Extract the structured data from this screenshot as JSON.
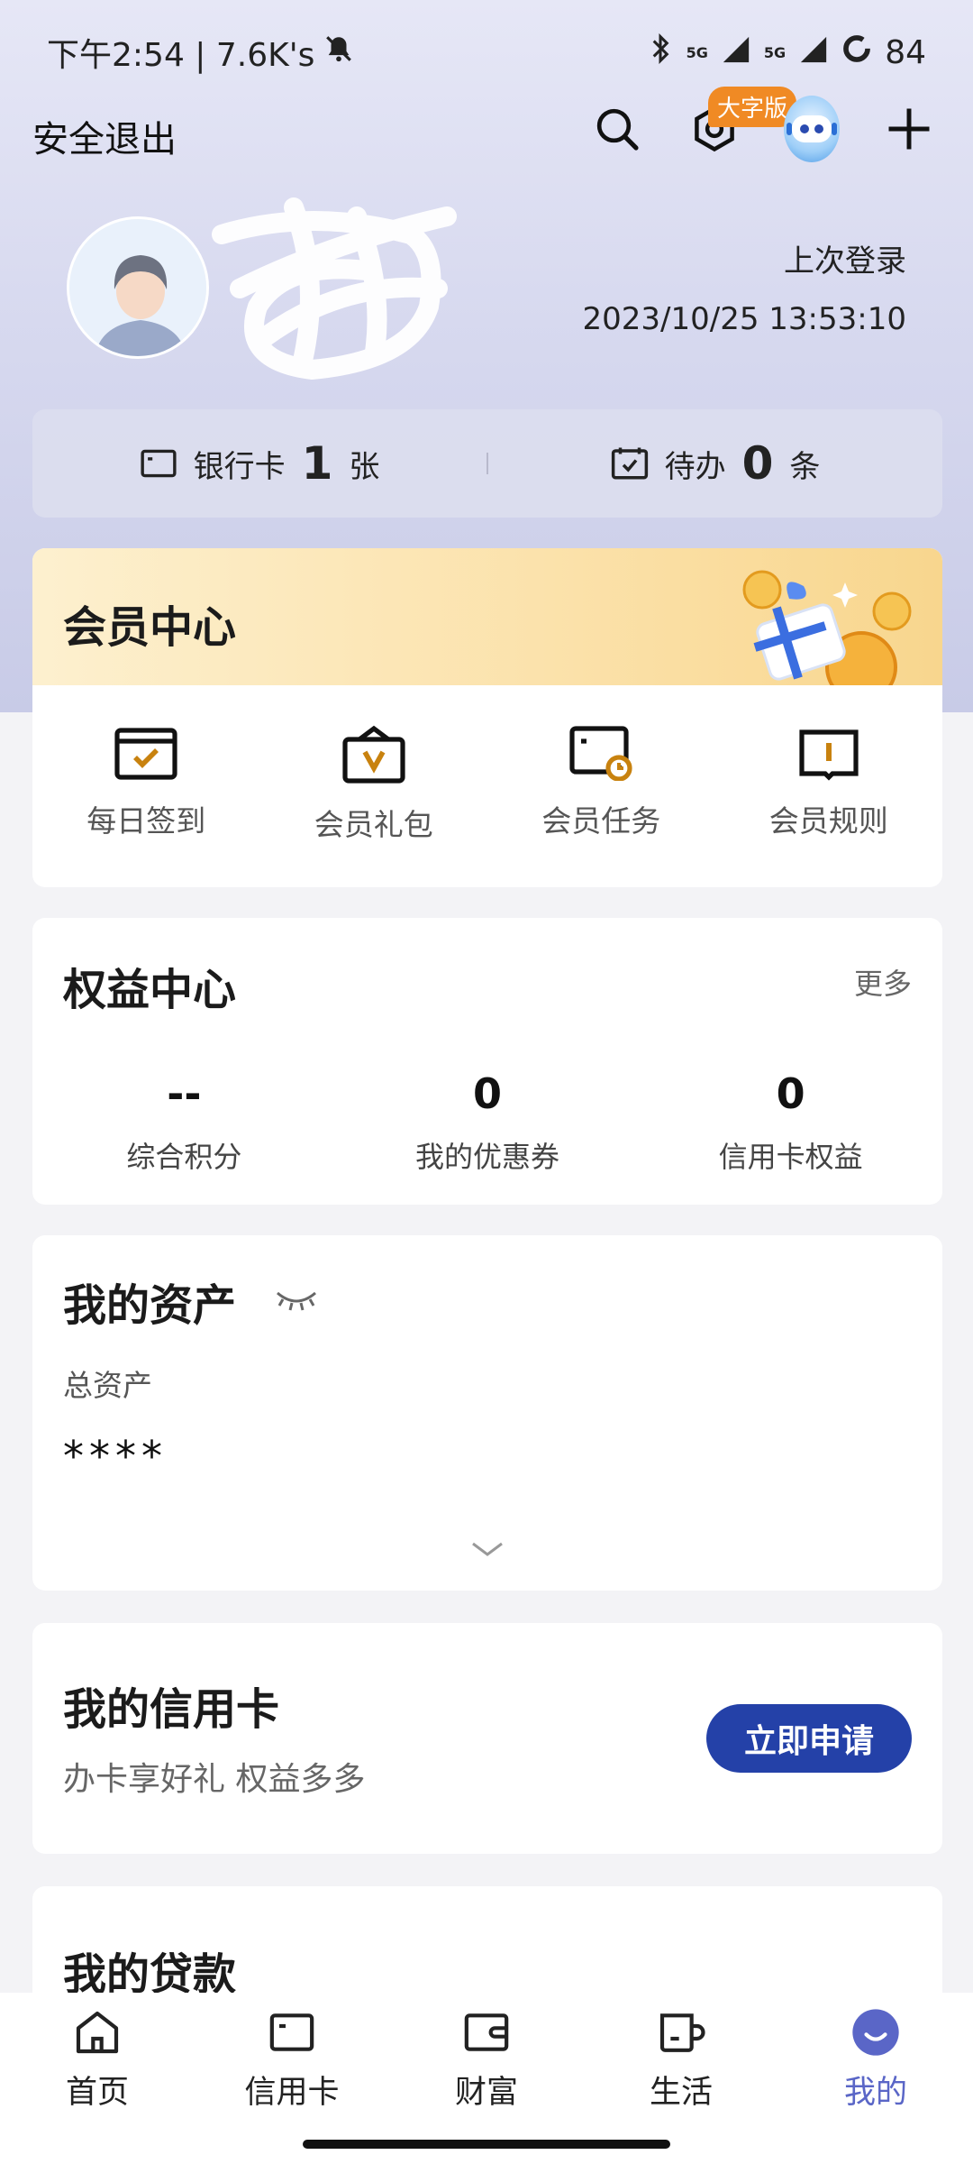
{
  "status_bar": {
    "time_speed": "下午2:54 | 7.6K's",
    "net1": "5G",
    "net2": "5G",
    "battery": "84"
  },
  "header": {
    "logout_label": "安全退出",
    "big_font_badge": "大字版"
  },
  "profile": {
    "last_login_label": "上次登录",
    "last_login_time": "2023/10/25 13:53:10"
  },
  "summary": {
    "bank_card_label": "银行卡",
    "bank_card_count": "1",
    "bank_card_unit": "张",
    "todo_label": "待办",
    "todo_count": "0",
    "todo_unit": "条"
  },
  "member_center": {
    "title": "会员中心",
    "items": [
      {
        "label": "每日签到",
        "icon": "calendar-check-icon"
      },
      {
        "label": "会员礼包",
        "icon": "gift-bag-icon"
      },
      {
        "label": "会员任务",
        "icon": "task-clock-icon"
      },
      {
        "label": "会员规则",
        "icon": "rule-book-icon"
      }
    ]
  },
  "rights_center": {
    "title": "权益中心",
    "more": "更多",
    "stats": [
      {
        "value": "--",
        "label": "综合积分"
      },
      {
        "value": "0",
        "label": "我的优惠券"
      },
      {
        "value": "0",
        "label": "信用卡权益"
      }
    ]
  },
  "assets": {
    "title": "我的资产",
    "total_label": "总资产",
    "total_value": "****"
  },
  "credit_card": {
    "title": "我的信用卡",
    "subtitle": "办卡享好礼 权益多多",
    "apply_label": "立即申请"
  },
  "loan": {
    "title": "我的贷款"
  },
  "tabbar": {
    "items": [
      {
        "label": "首页",
        "icon": "home-icon"
      },
      {
        "label": "信用卡",
        "icon": "credit-card-icon"
      },
      {
        "label": "财富",
        "icon": "wallet-icon"
      },
      {
        "label": "生活",
        "icon": "cup-icon"
      },
      {
        "label": "我的",
        "icon": "smile-icon"
      }
    ],
    "active_index": 4
  },
  "colors": {
    "accent": "#2441a8",
    "active_tab": "#5a66c7",
    "member_icon": "#c8820f",
    "badge": "#f08a24"
  }
}
